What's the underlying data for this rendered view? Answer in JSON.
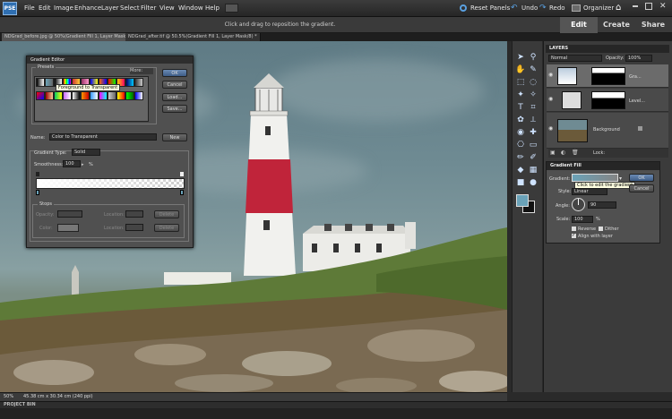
{
  "app": {
    "logo": "PSE"
  },
  "menu": [
    "File",
    "Edit",
    "Image",
    "Enhance",
    "Layer",
    "Select",
    "Filter",
    "View",
    "Window",
    "Help"
  ],
  "topright": {
    "reset_panels": "Reset Panels",
    "undo": "Undo",
    "redo": "Redo",
    "organizer": "Organizer"
  },
  "hint": "Click and drag to reposition the gradient.",
  "modes": {
    "edit": "Edit",
    "create": "Create",
    "share": "Share"
  },
  "doctabs": [
    "NDGrad_before.jpg @ 50%(Gradient Fill 1, Layer Mask/8) *",
    "NDGrad_after.tif @ 50.5%(Gradient Fill 1, Layer Mask/8) *"
  ],
  "status": {
    "zoom": "50%",
    "size": "45.38 cm x 30.34 cm (240 ppi)"
  },
  "projectbin": "PROJECT BIN",
  "layers": {
    "title": "LAYERS",
    "blend": "Normal",
    "opacity_label": "Opacity:",
    "opacity_value": "100%",
    "lock_label": "Lock:",
    "rows": [
      {
        "name": "Gra..."
      },
      {
        "name": "Level..."
      },
      {
        "name": "Background"
      }
    ]
  },
  "gradient_editor": {
    "title": "Gradient Editor",
    "presets_label": "Presets",
    "more_label": "More:",
    "tooltip": "Foreground to Transparent",
    "ok": "OK",
    "cancel": "Cancel",
    "load": "Load...",
    "save": "Save...",
    "name_label": "Name:",
    "name_value": "Color to Transparent",
    "new": "New",
    "type_label": "Gradient Type:",
    "type_value": "Solid",
    "smooth_label": "Smoothness:",
    "smooth_value": "100",
    "smooth_unit": "%",
    "stops_label": "Stops",
    "opacity_label": "Opacity:",
    "location_label": "Location:",
    "delete": "Delete",
    "color_label": "Color:",
    "location2_label": "Location:",
    "delete2": "Delete"
  },
  "gradient_fill": {
    "title": "Gradient Fill",
    "gradient_label": "Gradient:",
    "tooltip": "Click to edit the gradient",
    "ok": "OK",
    "cancel": "Cancel",
    "style_label": "Style:",
    "style_value": "Linear",
    "angle_label": "Angle:",
    "angle_value": "90",
    "scale_label": "Scale:",
    "scale_value": "100",
    "scale_unit": "%",
    "reverse": "Reverse",
    "dither": "Dither",
    "align": "Align with layer"
  },
  "colors": {
    "accent": "#6b8bb5",
    "fg_swatch": "#6aa2b8",
    "lighthouse_red": "#c0243a"
  }
}
